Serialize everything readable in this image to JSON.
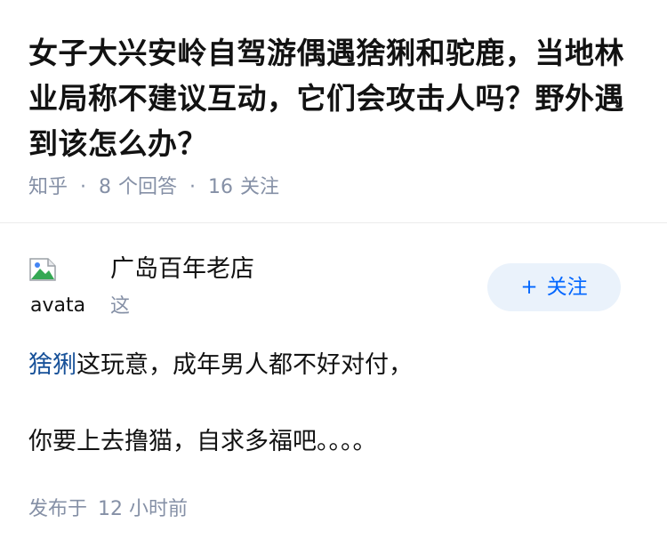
{
  "question": {
    "title": "女子大兴安岭自驾游偶遇猞猁和驼鹿，当地林业局称不建议互动，它们会攻击人吗？野外遇到该怎么办？",
    "source": "知乎",
    "separator": "·",
    "answer_count": "8",
    "answer_count_label": "个回答",
    "follower_count": "16",
    "follower_count_label": "关注"
  },
  "answer": {
    "author": {
      "avatar_alt": "avatar",
      "name": "广岛百年老店",
      "bio": "这"
    },
    "follow_button": {
      "icon": "plus-icon",
      "icon_glyph": "+",
      "label": "关注"
    },
    "content": {
      "link_text": "猞猁",
      "line1_rest": "这玩意，成年男人都不好对付，",
      "line2": "你要上去撸猫，自求多福吧。。。。"
    },
    "publish": {
      "label": "发布于",
      "time": "12 小时前"
    }
  },
  "colors": {
    "title": "#121212",
    "meta_gray": "#8590a6",
    "link_blue": "#175199",
    "follow_bg": "#eaf2fb",
    "follow_text": "#0066ff"
  }
}
